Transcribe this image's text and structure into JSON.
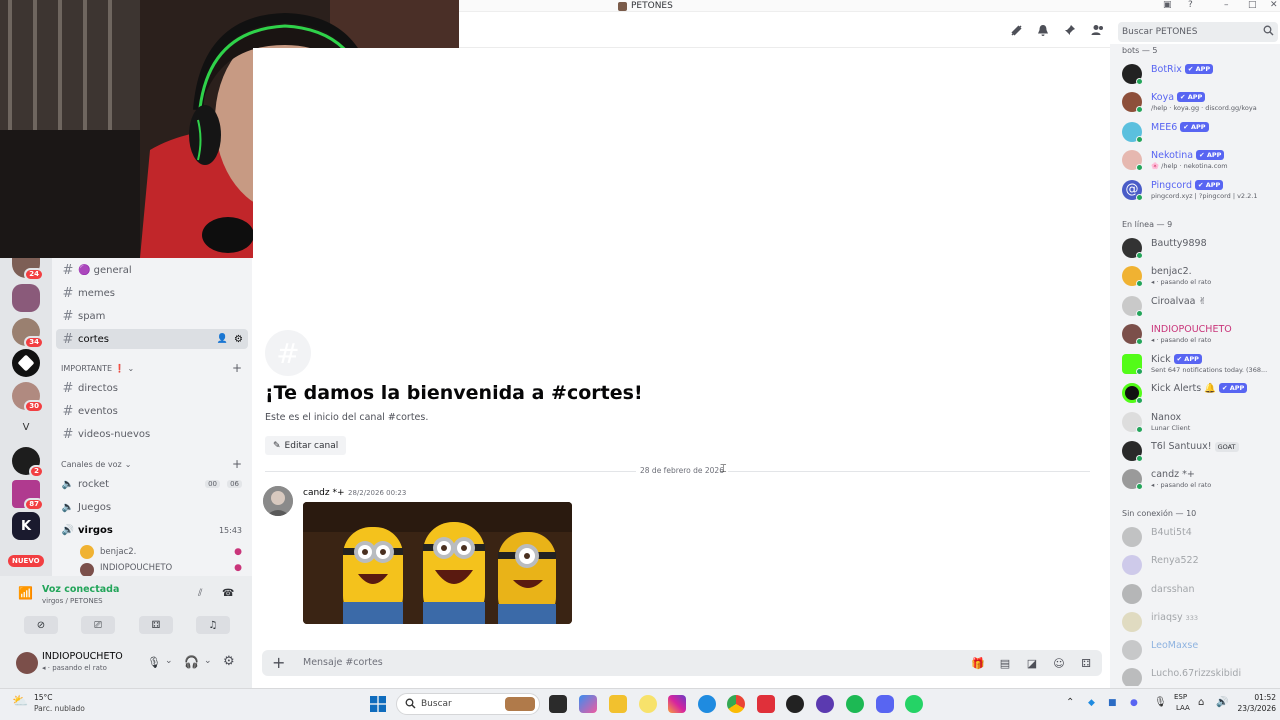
{
  "window": {
    "title": "PETONES"
  },
  "header": {
    "search_placeholder": "Buscar PETONES"
  },
  "channels": {
    "general": "🟣 general",
    "memes": "memes",
    "spam": "spam",
    "cortes": "cortes",
    "cat_importante": "IMPORTANTE ❗",
    "directos": "directos",
    "eventos": "eventos",
    "videos": "videos-nuevos",
    "cat_voz": "Canales de voz",
    "rocket": "rocket",
    "rocket_c1": "00",
    "rocket_c2": "06",
    "juegos": "Juegos",
    "virgos": "virgos",
    "virgos_time": "15:43",
    "voice_user1": "benjac2.",
    "voice_user2": "INDIOPOUCHETO"
  },
  "rail": {
    "badges": [
      "24",
      "34",
      "30",
      "2",
      "87"
    ],
    "new_label": "NUEVO"
  },
  "voice": {
    "status": "Voz conectada",
    "location": "virgos / PETONES"
  },
  "user": {
    "name": "INDIOPOUCHETO",
    "status": "pasando el rato"
  },
  "welcome": {
    "title": "¡Te damos la bienvenida a #cortes!",
    "subtitle": "Este es el inicio del canal #cortes.",
    "edit_button": "Editar canal"
  },
  "messages": {
    "date_divider": "28 de febrero de 2026",
    "author": "candz *+",
    "timestamp": "28/2/2026 00:23"
  },
  "composer": {
    "placeholder": "Mensaje #cortes"
  },
  "members": {
    "bots_header": "bots — 5",
    "online_header": "En línea — 9",
    "offline_header": "Sin conexión — 10",
    "app_badge": "✔ APP",
    "bots": [
      {
        "name": "BotRix",
        "status": ""
      },
      {
        "name": "Koya",
        "status": "/help · koya.gg · discord.gg/koya"
      },
      {
        "name": "MEE6",
        "status": ""
      },
      {
        "name": "Nekotina",
        "status": "🌸 /help · nekotina.com"
      },
      {
        "name": "Pingcord",
        "status": "pingcord.xyz | ?pingcord | v2.2.1"
      }
    ],
    "online": [
      {
        "name": "Bautty9898",
        "status": ""
      },
      {
        "name": "benjac2.",
        "status": "pasando el rato"
      },
      {
        "name": "Ciroalvaa ✌",
        "status": ""
      },
      {
        "name": "INDIOPOUCHETO",
        "status": "pasando el rato"
      },
      {
        "name": "Kick",
        "status": "Sent 647 notifications today. (368..."
      },
      {
        "name": "Kick Alerts 🔔",
        "status": ""
      },
      {
        "name": "Nanox",
        "status": "Lunar Client"
      },
      {
        "name": "T6l Santuux!",
        "status": "",
        "tag": "GOAT"
      },
      {
        "name": "candz *+",
        "status": "pasando el rato"
      }
    ],
    "offline": [
      {
        "name": "B4uti5t4",
        "status": ""
      },
      {
        "name": "Renya522",
        "status": ""
      },
      {
        "name": "darsshan",
        "status": ""
      },
      {
        "name": "iriaqsy",
        "status": "",
        "tag": "333"
      },
      {
        "name": "LeoMaxse",
        "status": ""
      },
      {
        "name": "Lucho.67rizzskibidi",
        "status": ""
      }
    ]
  },
  "taskbar": {
    "weather_temp": "15°C",
    "weather_desc": "Parc. nublado",
    "search": "Buscar",
    "lang1": "ESP",
    "lang2": "LAA",
    "time": "01:52",
    "date": "23/3/2026"
  },
  "colors": {
    "accent": "#5865f2",
    "online": "#23a55a",
    "badge": "#f23f42",
    "mention": "#c9357a"
  }
}
